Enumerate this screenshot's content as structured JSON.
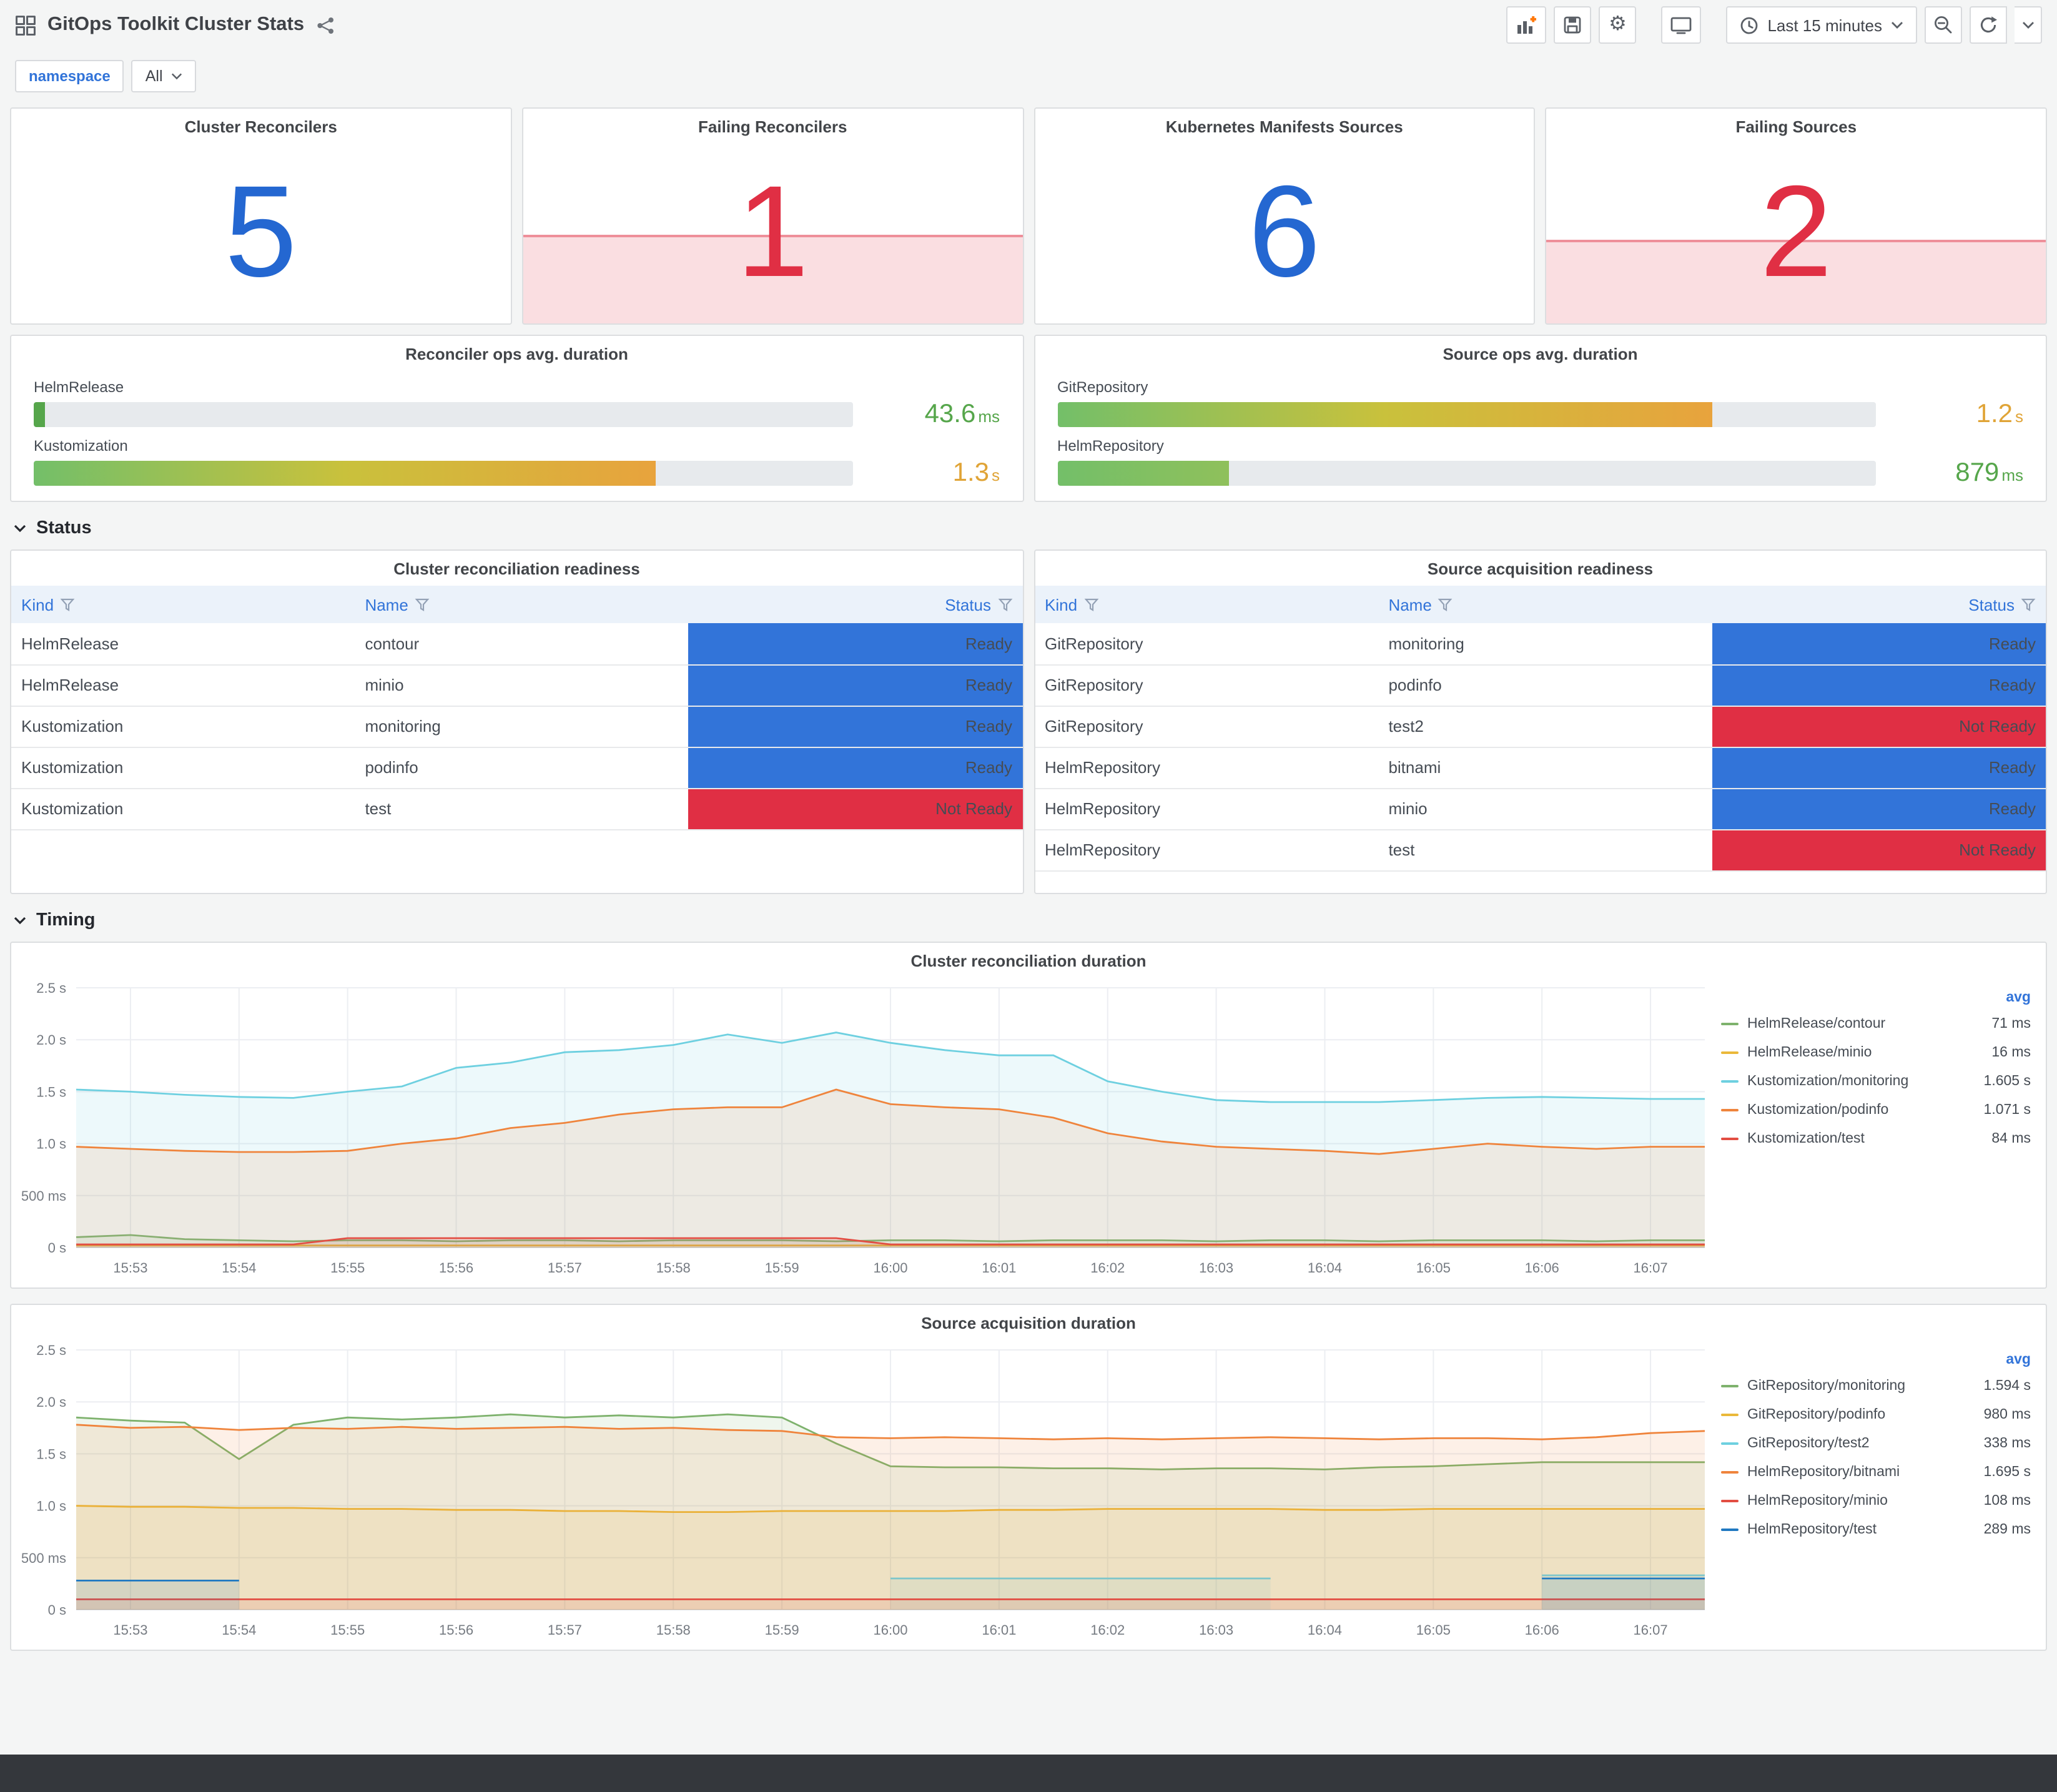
{
  "colors": {
    "accent_blue": "#3274D9",
    "stat_blue": "#2467D1",
    "alert_red": "#E02F44",
    "ready_bg": "#3274D9",
    "not_ready_bg": "#E02F44",
    "green_text": "#56A64B",
    "amber_text": "#E0A437"
  },
  "header": {
    "title": "GitOps Toolkit Cluster Stats",
    "time_picker_label": "Last 15 minutes"
  },
  "filters": {
    "name_label": "namespace",
    "value": "All"
  },
  "stats": [
    {
      "title": "Cluster Reconcilers",
      "value": "5",
      "state": "normal"
    },
    {
      "title": "Failing Reconcilers",
      "value": "1",
      "state": "alerting"
    },
    {
      "title": "Kubernetes Manifests Sources",
      "value": "6",
      "state": "normal"
    },
    {
      "title": "Failing Sources",
      "value": "2",
      "state": "alerting"
    }
  ],
  "gauge_panels": [
    {
      "title": "Reconciler ops avg. duration",
      "rows": [
        {
          "label": "HelmRelease",
          "value": "43.6",
          "unit": "ms",
          "pct": 1.4,
          "bar_colors": [
            "#56A64B"
          ],
          "value_color": "#56A64B"
        },
        {
          "label": "Kustomization",
          "value": "1.3",
          "unit": "s",
          "pct": 76,
          "bar_colors": [
            "#73BF69",
            "#C9C13C",
            "#E8A33D"
          ],
          "value_color": "#E0A437"
        }
      ]
    },
    {
      "title": "Source ops avg. duration",
      "rows": [
        {
          "label": "GitRepository",
          "value": "1.2",
          "unit": "s",
          "pct": 80,
          "bar_colors": [
            "#73BF69",
            "#C9C13C",
            "#E8A33D"
          ],
          "value_color": "#E0A437"
        },
        {
          "label": "HelmRepository",
          "value": "879",
          "unit": "ms",
          "pct": 21,
          "bar_colors": [
            "#73BF69",
            "#8FC05B"
          ],
          "value_color": "#56A64B"
        }
      ]
    }
  ],
  "sections": {
    "status": "Status",
    "timing": "Timing"
  },
  "tables": [
    {
      "title": "Cluster reconciliation readiness",
      "columns": [
        "Kind",
        "Name",
        "Status"
      ],
      "rows": [
        [
          "HelmRelease",
          "contour",
          "Ready"
        ],
        [
          "HelmRelease",
          "minio",
          "Ready"
        ],
        [
          "Kustomization",
          "monitoring",
          "Ready"
        ],
        [
          "Kustomization",
          "podinfo",
          "Ready"
        ],
        [
          "Kustomization",
          "test",
          "Not Ready"
        ]
      ]
    },
    {
      "title": "Source acquisition readiness",
      "columns": [
        "Kind",
        "Name",
        "Status"
      ],
      "rows": [
        [
          "GitRepository",
          "monitoring",
          "Ready"
        ],
        [
          "GitRepository",
          "podinfo",
          "Ready"
        ],
        [
          "GitRepository",
          "test2",
          "Not Ready"
        ],
        [
          "HelmRepository",
          "bitnami",
          "Ready"
        ],
        [
          "HelmRepository",
          "minio",
          "Ready"
        ],
        [
          "HelmRepository",
          "test",
          "Not Ready"
        ]
      ]
    }
  ],
  "chart_data": [
    {
      "type": "line",
      "title": "Cluster reconciliation duration",
      "ylim": [
        0,
        2.5
      ],
      "points": 31,
      "legend_header": "avg",
      "legend_position": "right",
      "grid": true,
      "yticks": [
        {
          "v": 0,
          "label": "0 s"
        },
        {
          "v": 0.5,
          "label": "500 ms"
        },
        {
          "v": 1,
          "label": "1.0 s"
        },
        {
          "v": 1.5,
          "label": "1.5 s"
        },
        {
          "v": 2,
          "label": "2.0 s"
        },
        {
          "v": 2.5,
          "label": "2.5 s"
        }
      ],
      "xticklabels": [
        "15:53",
        "15:54",
        "15:55",
        "15:56",
        "15:57",
        "15:58",
        "15:59",
        "16:00",
        "16:01",
        "16:02",
        "16:03",
        "16:04",
        "16:05",
        "16:06",
        "16:07"
      ],
      "series": [
        {
          "name": "HelmRelease/contour",
          "avg": "71 ms",
          "color": "#7EB26D",
          "values": [
            0.1,
            0.12,
            0.08,
            0.07,
            0.06,
            0.07,
            0.07,
            0.06,
            0.07,
            0.07,
            0.06,
            0.07,
            0.07,
            0.07,
            0.06,
            0.07,
            0.07,
            0.06,
            0.07,
            0.07,
            0.07,
            0.06,
            0.07,
            0.07,
            0.06,
            0.07,
            0.07,
            0.07,
            0.06,
            0.07,
            0.07
          ]
        },
        {
          "name": "HelmRelease/minio",
          "avg": "16 ms",
          "color": "#EAB839",
          "values": [
            0.02,
            0.02,
            0.02,
            0.02,
            0.02,
            0.02,
            0.02,
            0.02,
            0.02,
            0.02,
            0.02,
            0.02,
            0.02,
            0.02,
            0.02,
            0.02,
            0.02,
            0.02,
            0.02,
            0.02,
            0.02,
            0.02,
            0.02,
            0.02,
            0.02,
            0.02,
            0.02,
            0.02,
            0.02,
            0.02,
            0.02
          ]
        },
        {
          "name": "Kustomization/monitoring",
          "avg": "1.605 s",
          "color": "#6ED0E0",
          "values": [
            1.52,
            1.5,
            1.47,
            1.45,
            1.44,
            1.5,
            1.55,
            1.73,
            1.78,
            1.88,
            1.9,
            1.95,
            2.05,
            1.97,
            2.07,
            1.97,
            1.9,
            1.85,
            1.85,
            1.6,
            1.5,
            1.42,
            1.4,
            1.4,
            1.4,
            1.42,
            1.44,
            1.45,
            1.44,
            1.43,
            1.43
          ]
        },
        {
          "name": "Kustomization/podinfo",
          "avg": "1.071 s",
          "color": "#EF843C",
          "values": [
            0.97,
            0.95,
            0.93,
            0.92,
            0.92,
            0.93,
            1.0,
            1.05,
            1.15,
            1.2,
            1.28,
            1.33,
            1.35,
            1.35,
            1.52,
            1.38,
            1.35,
            1.33,
            1.25,
            1.1,
            1.02,
            0.97,
            0.95,
            0.93,
            0.9,
            0.95,
            1.0,
            0.97,
            0.95,
            0.97,
            0.97
          ]
        },
        {
          "name": "Kustomization/test",
          "avg": "84 ms",
          "color": "#E24D42",
          "values": [
            0.03,
            0.03,
            0.03,
            0.03,
            0.03,
            0.09,
            0.09,
            0.09,
            0.09,
            0.09,
            0.09,
            0.09,
            0.09,
            0.09,
            0.09,
            0.03,
            0.03,
            0.03,
            0.03,
            0.03,
            0.03,
            0.03,
            0.03,
            0.03,
            0.03,
            0.03,
            0.03,
            0.03,
            0.03,
            0.03,
            0.03
          ]
        }
      ]
    },
    {
      "type": "line",
      "title": "Source acquisition duration",
      "ylim": [
        0,
        2.5
      ],
      "points": 31,
      "legend_header": "avg",
      "legend_position": "right",
      "grid": true,
      "yticks": [
        {
          "v": 0,
          "label": "0 s"
        },
        {
          "v": 0.5,
          "label": "500 ms"
        },
        {
          "v": 1,
          "label": "1.0 s"
        },
        {
          "v": 1.5,
          "label": "1.5 s"
        },
        {
          "v": 2,
          "label": "2.0 s"
        },
        {
          "v": 2.5,
          "label": "2.5 s"
        }
      ],
      "xticklabels": [
        "15:53",
        "15:54",
        "15:55",
        "15:56",
        "15:57",
        "15:58",
        "15:59",
        "16:00",
        "16:01",
        "16:02",
        "16:03",
        "16:04",
        "16:05",
        "16:06",
        "16:07"
      ],
      "series": [
        {
          "name": "GitRepository/monitoring",
          "avg": "1.594 s",
          "color": "#7EB26D",
          "values": [
            1.85,
            1.82,
            1.8,
            1.45,
            1.78,
            1.85,
            1.83,
            1.85,
            1.88,
            1.85,
            1.87,
            1.85,
            1.88,
            1.85,
            1.6,
            1.38,
            1.37,
            1.37,
            1.36,
            1.36,
            1.35,
            1.36,
            1.36,
            1.35,
            1.37,
            1.38,
            1.4,
            1.42,
            1.42,
            1.42,
            1.42
          ]
        },
        {
          "name": "GitRepository/podinfo",
          "avg": "980 ms",
          "color": "#EAB839",
          "values": [
            1.0,
            0.99,
            0.99,
            0.98,
            0.98,
            0.97,
            0.97,
            0.96,
            0.96,
            0.95,
            0.95,
            0.94,
            0.94,
            0.95,
            0.95,
            0.95,
            0.95,
            0.96,
            0.96,
            0.97,
            0.97,
            0.97,
            0.97,
            0.96,
            0.96,
            0.97,
            0.97,
            0.97,
            0.97,
            0.97,
            0.97
          ]
        },
        {
          "name": "GitRepository/test2",
          "avg": "338 ms",
          "color": "#6ED0E0",
          "values": [
            null,
            null,
            null,
            null,
            null,
            null,
            null,
            null,
            null,
            null,
            null,
            null,
            null,
            null,
            null,
            0.3,
            0.3,
            0.3,
            0.3,
            0.3,
            0.3,
            0.3,
            0.3,
            null,
            null,
            null,
            null,
            0.33,
            0.33,
            0.33,
            0.33
          ]
        },
        {
          "name": "HelmRepository/bitnami",
          "avg": "1.695 s",
          "color": "#EF843C",
          "values": [
            1.78,
            1.75,
            1.76,
            1.73,
            1.75,
            1.74,
            1.76,
            1.74,
            1.75,
            1.76,
            1.74,
            1.75,
            1.73,
            1.72,
            1.66,
            1.65,
            1.66,
            1.65,
            1.64,
            1.65,
            1.64,
            1.65,
            1.66,
            1.65,
            1.64,
            1.65,
            1.65,
            1.64,
            1.66,
            1.7,
            1.72
          ]
        },
        {
          "name": "HelmRepository/minio",
          "avg": "108 ms",
          "color": "#E24D42",
          "values": [
            0.1,
            0.1,
            0.1,
            0.1,
            0.1,
            0.1,
            0.1,
            0.1,
            0.1,
            0.1,
            0.1,
            0.1,
            0.1,
            0.1,
            0.1,
            0.1,
            0.1,
            0.1,
            0.1,
            0.1,
            0.1,
            0.1,
            0.1,
            0.1,
            0.1,
            0.1,
            0.1,
            0.1,
            0.1,
            0.1,
            0.1
          ]
        },
        {
          "name": "HelmRepository/test",
          "avg": "289 ms",
          "color": "#1F78C1",
          "values": [
            0.28,
            0.28,
            0.28,
            0.28,
            null,
            null,
            null,
            null,
            null,
            null,
            null,
            null,
            null,
            null,
            null,
            null,
            null,
            null,
            null,
            null,
            null,
            null,
            null,
            null,
            null,
            null,
            null,
            0.3,
            0.3,
            0.3,
            0.3
          ]
        }
      ]
    }
  ]
}
